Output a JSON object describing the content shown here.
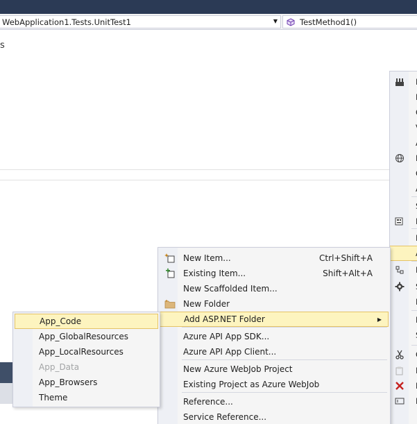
{
  "navbar": {
    "class_combo": "WebApplication1.Tests.UnitTest1",
    "method_combo": "TestMethod1()"
  },
  "editor": {
    "visible_glyph": "s"
  },
  "context_menu": {
    "items": [
      {
        "label": "New Item...",
        "shortcut": "Ctrl+Shift+A",
        "icon": "new-item-icon"
      },
      {
        "label": "Existing Item...",
        "shortcut": "Shift+Alt+A",
        "icon": "existing-item-icon"
      },
      {
        "label": "New Scaffolded Item...",
        "shortcut": "",
        "icon": ""
      },
      {
        "label": "New Folder",
        "shortcut": "",
        "icon": "folder-icon"
      },
      {
        "label": "Add ASP.NET Folder",
        "shortcut": "",
        "icon": "",
        "has_submenu": true,
        "highlighted": true
      },
      {
        "label": "Azure API App SDK...",
        "shortcut": "",
        "icon": ""
      },
      {
        "label": "Azure API App Client...",
        "shortcut": "",
        "icon": ""
      },
      {
        "label": "New Azure WebJob Project",
        "shortcut": "",
        "icon": ""
      },
      {
        "label": "Existing Project as Azure WebJob",
        "shortcut": "",
        "icon": ""
      },
      {
        "label": "Reference...",
        "shortcut": "",
        "icon": ""
      },
      {
        "label": "Service Reference...",
        "shortcut": "",
        "icon": ""
      }
    ],
    "submenu_arrow": "▶"
  },
  "submenu": {
    "items": [
      {
        "label": "App_Code",
        "highlighted": true
      },
      {
        "label": "App_GlobalResources"
      },
      {
        "label": "App_LocalResources"
      },
      {
        "label": "App_Data",
        "disabled": true
      },
      {
        "label": "App_Browsers"
      },
      {
        "label": "Theme"
      }
    ]
  },
  "right_menu": {
    "items": [
      {
        "label": "E",
        "icon": "build-icon"
      },
      {
        "label": "F",
        "icon": ""
      },
      {
        "label": "C",
        "icon": ""
      },
      {
        "label": "V",
        "icon": ""
      },
      {
        "label": "A",
        "icon": ""
      },
      {
        "label": "P",
        "icon": "publish-globe-icon"
      },
      {
        "label": "C",
        "icon": ""
      },
      {
        "label": "A",
        "icon": ""
      },
      {
        "label": "S",
        "icon": ""
      },
      {
        "label": "N",
        "icon": "nuget-icon"
      },
      {
        "label": "E",
        "icon": ""
      },
      {
        "label": "A",
        "icon": "",
        "highlighted": true
      },
      {
        "label": "N",
        "icon": "class-icon"
      },
      {
        "label": "S",
        "icon": "gear-icon"
      },
      {
        "label": "D",
        "icon": ""
      },
      {
        "label": "I",
        "icon": ""
      },
      {
        "label": "S",
        "icon": ""
      },
      {
        "label": "C",
        "icon": "cut-icon"
      },
      {
        "label": "P",
        "icon": "paste-icon"
      },
      {
        "label": "R",
        "icon": "remove-icon"
      },
      {
        "label": "R",
        "icon": "rename-icon"
      }
    ]
  },
  "colors": {
    "menu_bg": "#f5f5f5",
    "menu_gutter": "#eef0f5",
    "highlight_bg": "#fdf4bf",
    "highlight_border": "#e5c365",
    "disabled_text": "#a2a4a5",
    "title_strip": "#2b3a55"
  }
}
